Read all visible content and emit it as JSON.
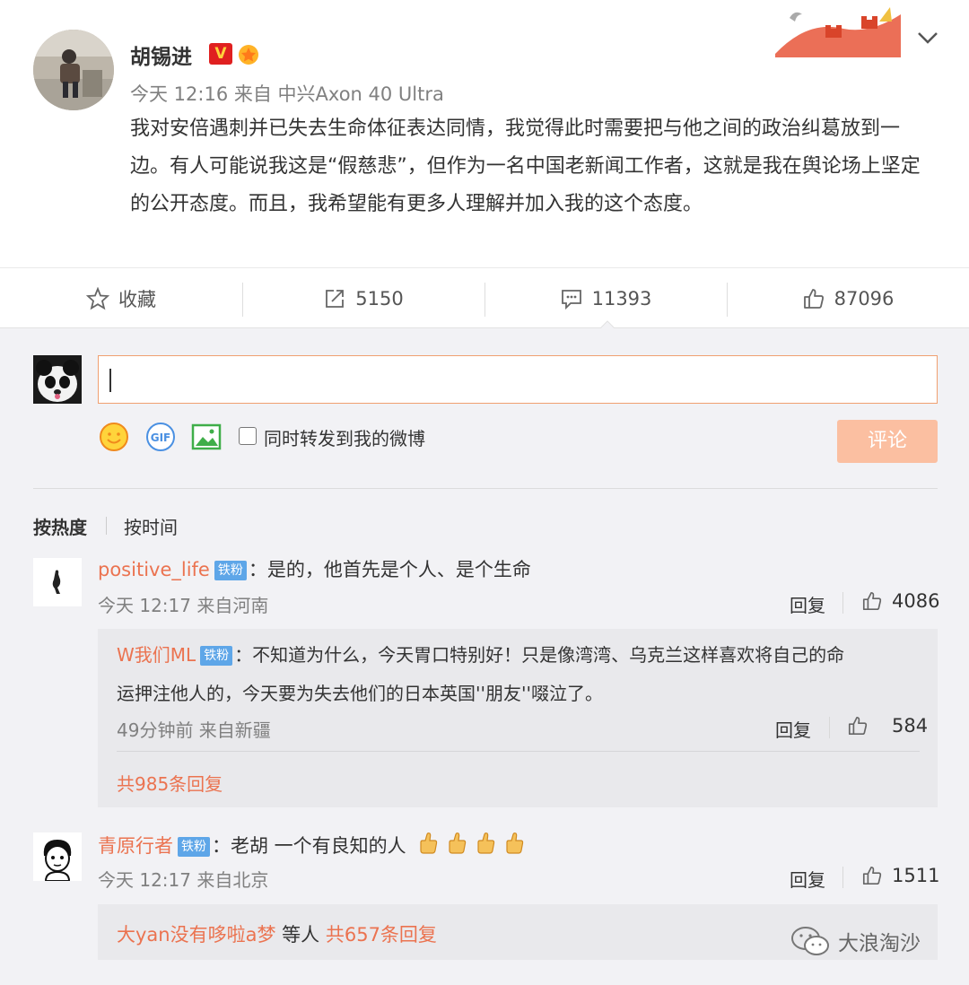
{
  "post": {
    "author": "胡锡进",
    "verified_badge": "V",
    "meta": "今天 12:16 来自 中兴Axon 40 Ultra",
    "text": "我对安倍遇刺并已失去生命体征表达同情，我觉得此时需要把与他之间的政治纠葛放到一边。有人可能说我这是“假慈悲”，但作为一名中国老新闻工作者，这就是我在舆论场上坚定的公开态度。而且，我希望能有更多人理解并加入我的这个态度。"
  },
  "actions": {
    "favorite": "收藏",
    "repost_count": "5150",
    "comment_count": "11393",
    "like_count": "87096"
  },
  "composer": {
    "sync_label": "同时转发到我的微博",
    "submit": "评论"
  },
  "sort": {
    "hot": "按热度",
    "time": "按时间"
  },
  "comments": [
    {
      "user": "positive_life",
      "badge": "铁粉",
      "text": "：是的，他首先是个人、是个生命",
      "meta": "今天 12:17 来自河南",
      "reply": "回复",
      "likes": "4086",
      "sub": {
        "user": "W我们ML",
        "badge": "铁粉",
        "text_line1": "：不知道为什么，今天胃口特别好！只是像湾湾、乌克兰这样喜欢将自己的命",
        "text_line2": "运押注他人的，今天要为失去他们的日本英国''朋友''啜泣了。",
        "meta": "49分钟前 来自新疆",
        "reply": "回复",
        "likes": "584",
        "more": "共985条回复"
      }
    },
    {
      "user": "青原行者",
      "badge": "铁粉",
      "text": "：老胡 一个有良知的人",
      "meta": "今天 12:17 来自北京",
      "reply": "回复",
      "likes": "1511",
      "sub": {
        "user": "大yan没有哆啦a梦",
        "middle": " 等人 ",
        "more": "共657条回复"
      }
    }
  ],
  "watermark": "大浪淘沙",
  "colors": {
    "accent": "#eb7350",
    "submit_bg": "#fbbfa1",
    "badge": "#5ea6e8",
    "vbadge": "#e02020"
  }
}
